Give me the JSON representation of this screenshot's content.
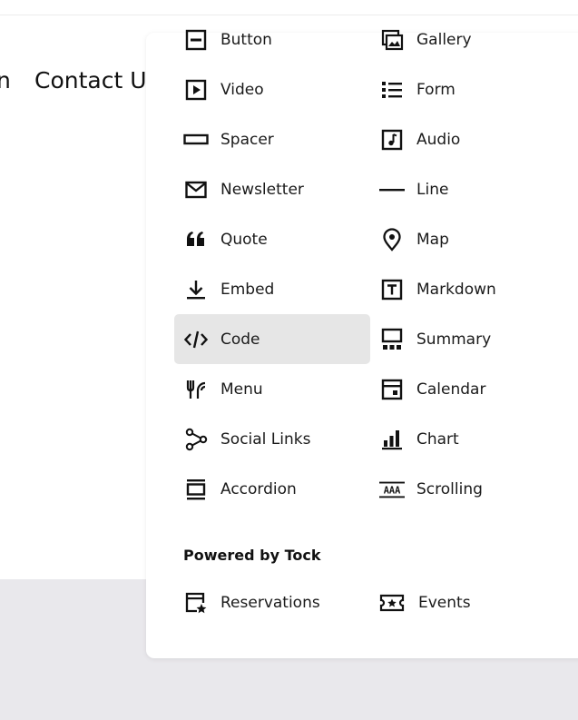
{
  "background": {
    "nav_fragment_left": "n",
    "nav_contact": "Contact U"
  },
  "blocks": {
    "left": [
      {
        "label": "Button",
        "icon": "button-icon"
      },
      {
        "label": "Video",
        "icon": "video-icon"
      },
      {
        "label": "Spacer",
        "icon": "spacer-icon"
      },
      {
        "label": "Newsletter",
        "icon": "newsletter-icon"
      },
      {
        "label": "Quote",
        "icon": "quote-icon"
      },
      {
        "label": "Embed",
        "icon": "embed-icon"
      },
      {
        "label": "Code",
        "icon": "code-icon",
        "state": "hovered"
      },
      {
        "label": "Menu",
        "icon": "menu-icon"
      },
      {
        "label": "Social Links",
        "icon": "social-links-icon"
      },
      {
        "label": "Accordion",
        "icon": "accordion-icon"
      }
    ],
    "right": [
      {
        "label": "Gallery",
        "icon": "gallery-icon"
      },
      {
        "label": "Form",
        "icon": "form-icon"
      },
      {
        "label": "Audio",
        "icon": "audio-icon"
      },
      {
        "label": "Line",
        "icon": "line-icon"
      },
      {
        "label": "Map",
        "icon": "map-icon"
      },
      {
        "label": "Markdown",
        "icon": "markdown-icon"
      },
      {
        "label": "Summary",
        "icon": "summary-icon"
      },
      {
        "label": "Calendar",
        "icon": "calendar-icon"
      },
      {
        "label": "Chart",
        "icon": "chart-icon"
      },
      {
        "label": "Scrolling",
        "icon": "scrolling-icon"
      }
    ]
  },
  "powered_by": {
    "title": "Powered by Tock",
    "items": [
      {
        "label": "Reservations",
        "icon": "reservations-icon"
      },
      {
        "label": "Events",
        "icon": "events-icon"
      }
    ]
  },
  "colors": {
    "hover_bg": "#e6e6e6",
    "bottom_band": "#e9e8ec",
    "icon": "#111111"
  }
}
